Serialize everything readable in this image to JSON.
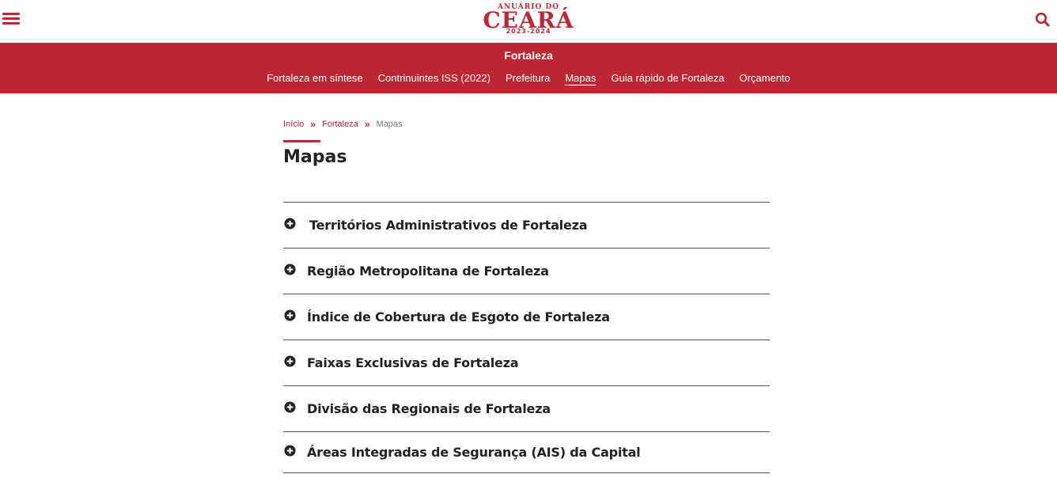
{
  "header": {
    "logo": {
      "line1": "ANUÁRIO DO",
      "line2": "CEARÁ",
      "years": "2023-2024"
    },
    "menu_icon": "hamburger-menu-icon",
    "search_icon": "search-icon"
  },
  "section": {
    "title": "Fortaleza",
    "nav": [
      {
        "label": "Fortaleza em síntese",
        "active": false
      },
      {
        "label": "Contrinuintes ISS (2022)",
        "active": false
      },
      {
        "label": "Prefeitura",
        "active": false
      },
      {
        "label": "Mapas",
        "active": true
      },
      {
        "label": "Guia rápido de Fortaleza",
        "active": false
      },
      {
        "label": "Orçamento",
        "active": false
      }
    ]
  },
  "breadcrumb": {
    "items": [
      "Início",
      "Fortaleza"
    ],
    "separator": "»",
    "current": "Mapas"
  },
  "page": {
    "title": "Mapas"
  },
  "accordion": {
    "icon": "plus-circle-icon",
    "items": [
      "Territórios Administrativos de Fortaleza",
      "Região Metropolitana de Fortaleza",
      "Índice de Cobertura de Esgoto de Fortaleza",
      "Faixas Exclusivas de Fortaleza",
      "Divisão das Regionais de Fortaleza",
      "Áreas Integradas de Segurança (AIS) da Capital"
    ]
  },
  "colors": {
    "brand_red": "#bf2633",
    "text_dark": "#222222",
    "divider": "#555555"
  }
}
